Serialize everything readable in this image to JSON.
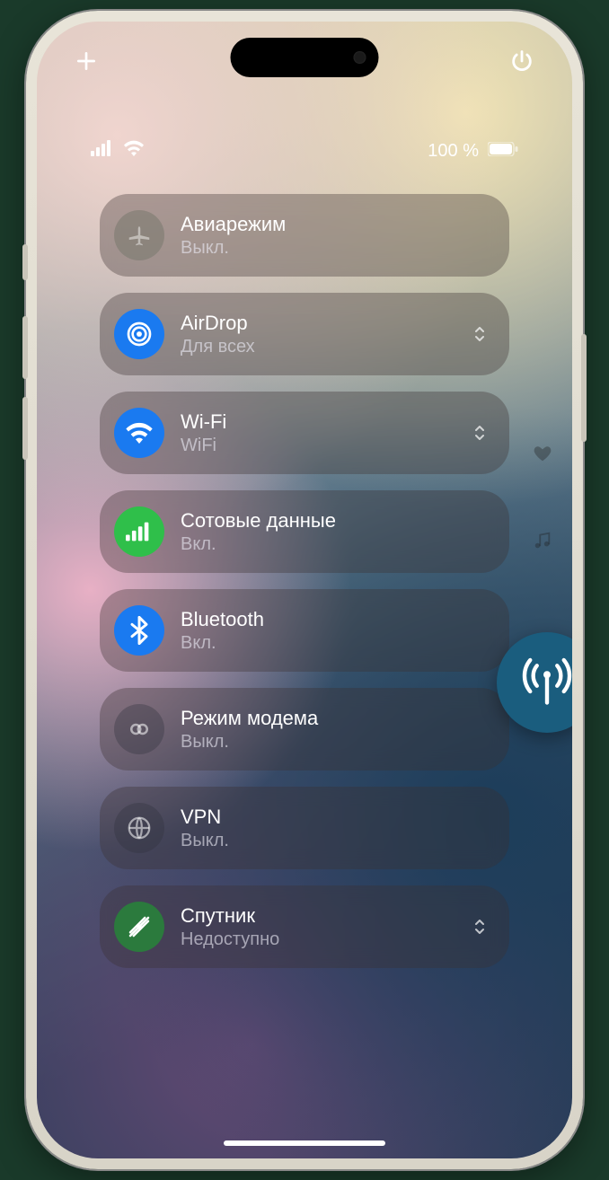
{
  "status": {
    "battery_text": "100 %"
  },
  "rows": [
    {
      "title": "Авиарежим",
      "subtitle": "Выкл.",
      "icon": "airplane",
      "color": "off",
      "chevron": false
    },
    {
      "title": "AirDrop",
      "subtitle": "Для всех",
      "icon": "airdrop",
      "color": "blue",
      "chevron": true
    },
    {
      "title": "Wi-Fi",
      "subtitle": "WiFi",
      "icon": "wifi",
      "color": "blue",
      "chevron": true
    },
    {
      "title": "Сотовые данные",
      "subtitle": "Вкл.",
      "icon": "cellular",
      "color": "green",
      "chevron": false
    },
    {
      "title": "Bluetooth",
      "subtitle": "Вкл.",
      "icon": "bluetooth",
      "color": "blue",
      "chevron": false
    },
    {
      "title": "Режим модема",
      "subtitle": "Выкл.",
      "icon": "hotspot",
      "color": "off-dark",
      "chevron": false
    },
    {
      "title": "VPN",
      "subtitle": "Выкл.",
      "icon": "vpn",
      "color": "off-dark",
      "chevron": false
    },
    {
      "title": "Спутник",
      "subtitle": "Недоступно",
      "icon": "satellite",
      "color": "dgreen",
      "chevron": true
    }
  ]
}
